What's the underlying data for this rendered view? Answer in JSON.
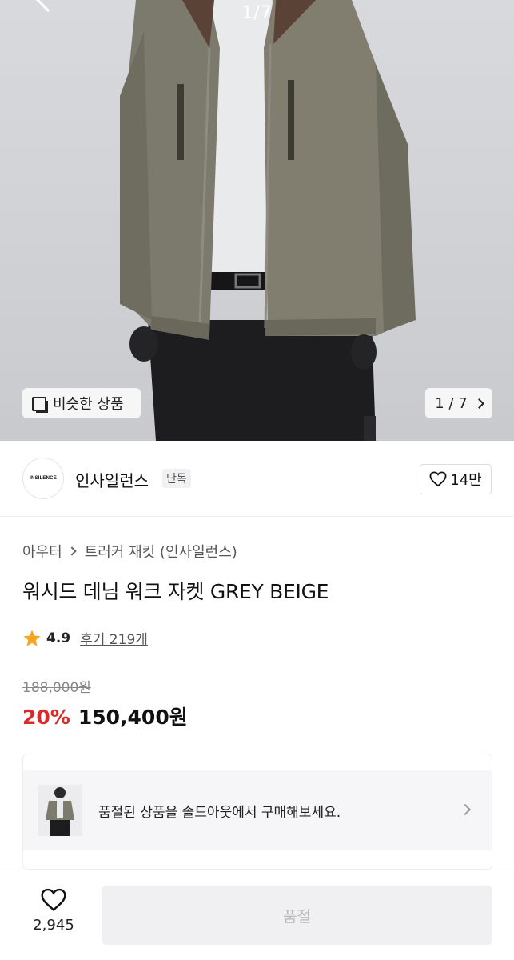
{
  "gallery": {
    "top_counter": "1/7",
    "similar_products_label": "비슷한 상품",
    "pager_label": "1 / 7"
  },
  "brand": {
    "logo_text": "INSILENCE",
    "name": "인사일런스",
    "tag": "단독",
    "likes": "14만"
  },
  "product": {
    "breadcrumb": [
      "아우터",
      "트러커 재킷 (인사일런스)"
    ],
    "title": "워시드 데님 워크 자켓 GREY BEIGE",
    "rating": "4.9",
    "review_label": "후기 219개",
    "original_price": "188,000원",
    "discount": "20%",
    "price": "150,400원"
  },
  "soldout": {
    "message": "품절된 상품을 솔드아웃에서 구매해보세요."
  },
  "bottom": {
    "wish_count": "2,945",
    "buy_label": "품절"
  },
  "colors": {
    "discount": "#d92b2b",
    "star": "#f5a623"
  }
}
